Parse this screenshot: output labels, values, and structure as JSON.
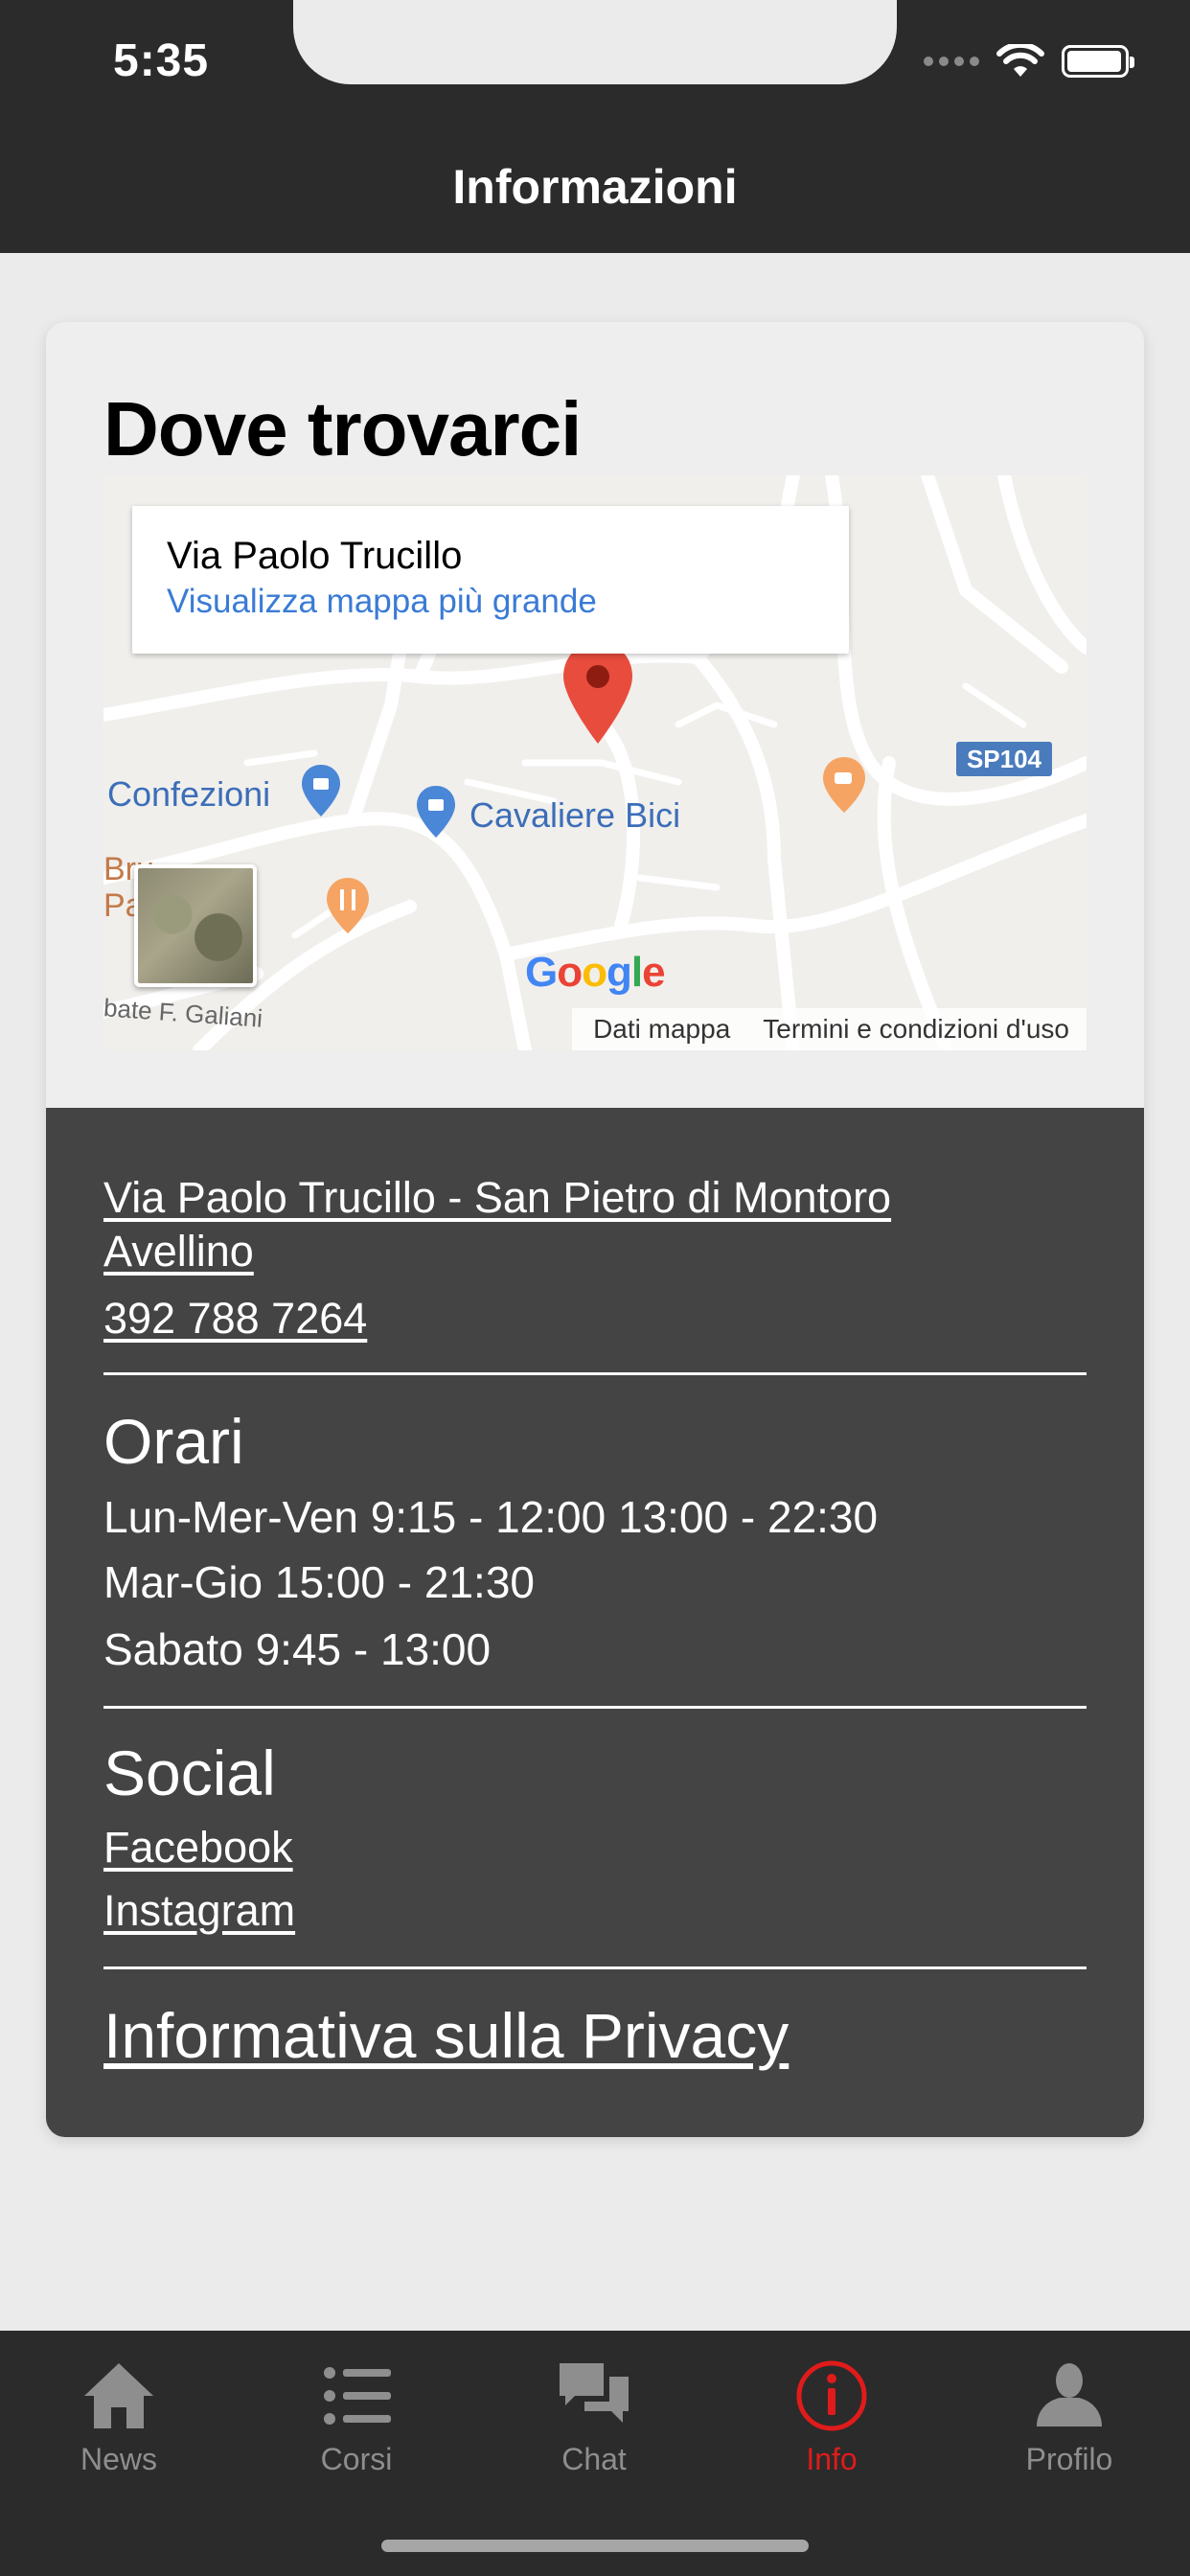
{
  "status_bar": {
    "time": "5:35"
  },
  "header": {
    "title": "Informazioni"
  },
  "location": {
    "title": "Dove trovarci",
    "map": {
      "popup_title": "Via Paolo Trucillo",
      "popup_link": "Visualizza mappa più grande",
      "labels": {
        "confezioni": "Confezioni",
        "cavaliere_bici": "Cavaliere Bici",
        "galiani": "bate F. Galiani",
        "road_badge": "SP104",
        "br": "Bru",
        "pa": "Pa"
      },
      "google": "Google",
      "footer_data": "Dati mappa",
      "footer_terms": "Termini e condizioni d'uso"
    }
  },
  "contact": {
    "address_line1": "Via Paolo Trucillo - San Pietro di Montoro",
    "address_line2": "Avellino",
    "phone": "392 788 7264"
  },
  "hours": {
    "title": "Orari",
    "lines": [
      "Lun-Mer-Ven 9:15 - 12:00 13:00 - 22:30",
      "Mar-Gio 15:00 - 21:30",
      "Sabato 9:45 - 13:00"
    ]
  },
  "social": {
    "title": "Social",
    "links": [
      "Facebook",
      "Instagram"
    ]
  },
  "privacy_link": "Informativa sulla Privacy",
  "tabbar": {
    "items": [
      {
        "label": "News",
        "icon": "home-icon"
      },
      {
        "label": "Corsi",
        "icon": "list-icon"
      },
      {
        "label": "Chat",
        "icon": "chat-icon"
      },
      {
        "label": "Info",
        "icon": "info-icon",
        "active": true
      },
      {
        "label": "Profilo",
        "icon": "person-icon"
      }
    ],
    "active_color": "#e01b1b",
    "inactive_color": "#8e8e8e"
  }
}
